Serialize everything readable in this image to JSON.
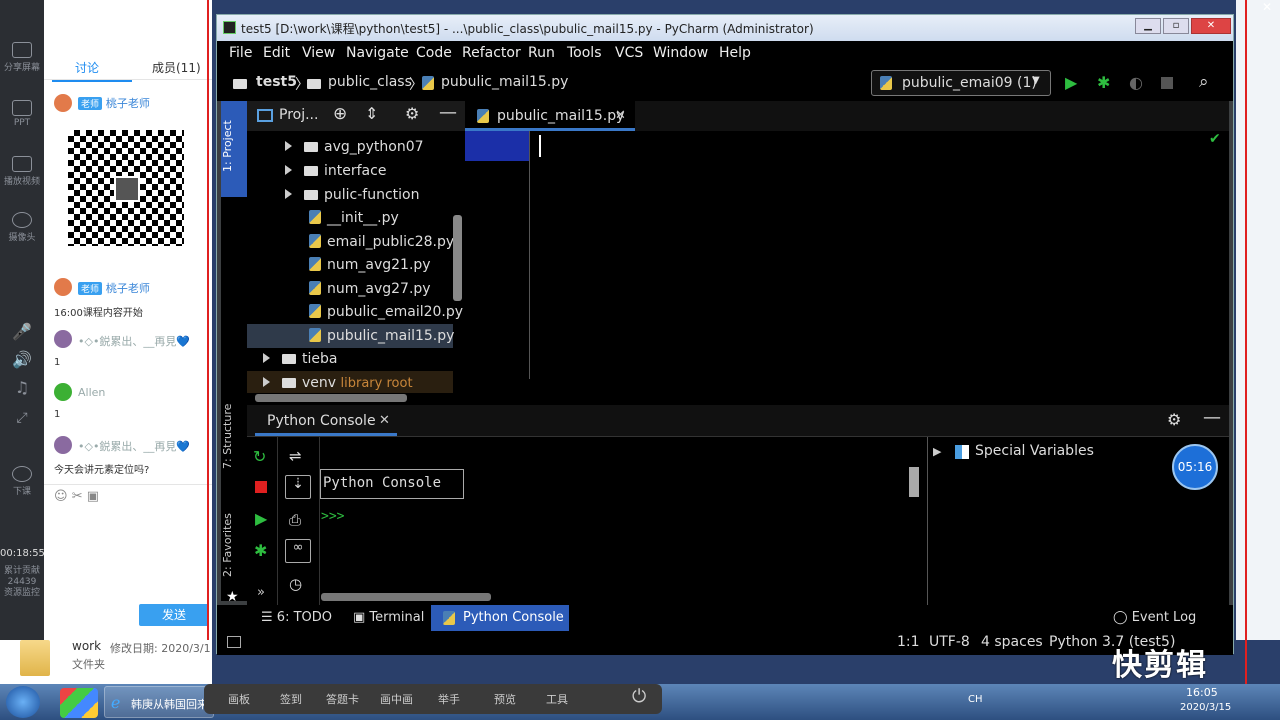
{
  "chat_app": {
    "share_screen": "分享屏幕",
    "left_items": [
      "PPT",
      "播放视频",
      "摄像头",
      "下课"
    ],
    "timer": "00:18:55",
    "stats": [
      "累计贡献",
      "24439",
      "资源监控"
    ],
    "tabs": [
      "讨论",
      "成员(11)"
    ],
    "messages": [
      {
        "badge": "老师",
        "name": "桃子老师",
        "text": ""
      },
      {
        "badge": "老师",
        "name": "桃子老师",
        "text": "16:00课程内容开始"
      },
      {
        "badge": "",
        "name": "•◇•鋭累出、__再見💙",
        "text": "1"
      },
      {
        "badge": "",
        "name": "Allen",
        "text": "1"
      },
      {
        "badge": "",
        "name": "•◇•鋭累出、__再見💙",
        "text": "今天会讲元素定位吗?"
      }
    ],
    "send": "发送"
  },
  "pycharm": {
    "title": "test5 [D:\\work\\课程\\python\\test5] - ...\\public_class\\pubulic_mail15.py - PyCharm (Administrator)",
    "menu": [
      "File",
      "Edit",
      "View",
      "Navigate",
      "Code",
      "Refactor",
      "Run",
      "Tools",
      "VCS",
      "Window",
      "Help"
    ],
    "breadcrumb": [
      "test5",
      "public_class",
      "pubulic_mail15.py"
    ],
    "run_config": "pubulic_emai09 (1)",
    "project_label": "Proj...",
    "side_labels": [
      "1: Project",
      "7: Structure",
      "2: Favorites"
    ],
    "tree": [
      {
        "type": "folder",
        "label": "avg_python07"
      },
      {
        "type": "folder",
        "label": "interface"
      },
      {
        "type": "folder",
        "label": "pulic-function"
      },
      {
        "type": "file",
        "label": "__init__.py"
      },
      {
        "type": "file",
        "label": "email_public28.py"
      },
      {
        "type": "file",
        "label": "num_avg21.py"
      },
      {
        "type": "file",
        "label": "num_avg27.py"
      },
      {
        "type": "file",
        "label": "pubulic_email20.py"
      },
      {
        "type": "file",
        "label": "pubulic_mail15.py"
      },
      {
        "type": "folder",
        "label": "tieba"
      },
      {
        "type": "folder",
        "label": "venv",
        "extra": "library root"
      }
    ],
    "editor_tab": "pubulic_mail15.py",
    "console_tab": "Python Console",
    "console_label": "Python Console",
    "prompt": ">>>",
    "special_vars": "Special Variables",
    "clock": "05:16",
    "bottom_tabs": [
      "6: TODO",
      "Terminal",
      "Python Console"
    ],
    "event_log": "Event Log",
    "status": {
      "pos": "1:1",
      "enc": "UTF-8",
      "indent": "4 spaces",
      "interp": "Python 3.7 (test5)"
    }
  },
  "explorer": {
    "name": "work",
    "modified": "修改日期: 2020/3/1",
    "kind": "文件夹"
  },
  "toolbar": [
    "画板",
    "签到",
    "答题卡",
    "画中画",
    "举手",
    "预览",
    "工具"
  ],
  "taskbar": {
    "ie_label": "韩庚从韩国回来",
    "time": "16:05",
    "date": "2020/3/15",
    "lang": "CH"
  },
  "watermark": "快剪辑"
}
